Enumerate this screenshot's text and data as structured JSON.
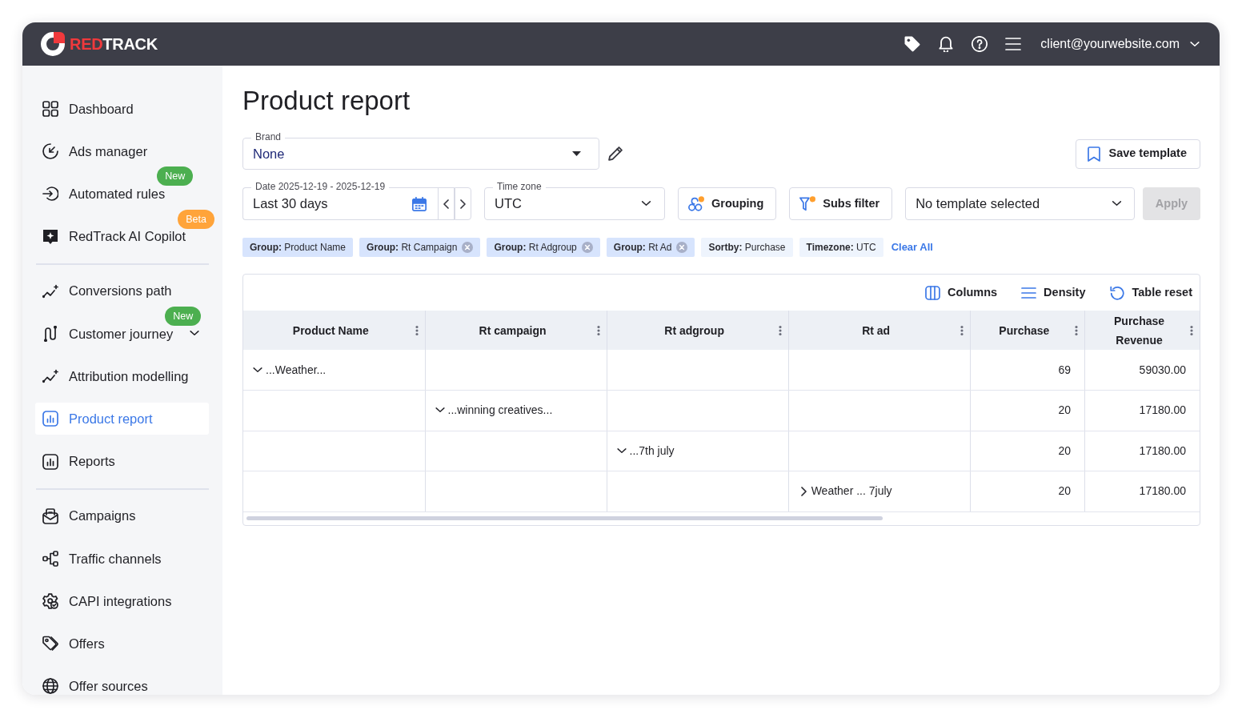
{
  "top_bar": {
    "logo": {
      "accent": "RED",
      "rest": "TRACK"
    },
    "account": {
      "email": "client@yourwebsite.com"
    }
  },
  "sidebar": {
    "sections": [
      {
        "items": [
          {
            "label": "Dashboard",
            "kind": "link",
            "selected": false
          },
          {
            "label": "Ads manager",
            "kind": "link",
            "selected": false
          },
          {
            "label": "Automated rules",
            "kind": "link",
            "selected": false,
            "badge": {
              "text": "New",
              "color": "#4caf50"
            }
          },
          {
            "label": "RedTrack AI Copilot",
            "kind": "link",
            "selected": false,
            "badge": {
              "text": "Beta",
              "color": "#ffa43a"
            }
          }
        ]
      },
      {
        "items": [
          {
            "label": "Conversions path",
            "kind": "link",
            "selected": false
          },
          {
            "label": "Customer journey",
            "kind": "group",
            "expanded": false,
            "selected": false,
            "badge": {
              "text": "New",
              "color": "#4caf50"
            }
          },
          {
            "label": "Attribution modelling",
            "kind": "link",
            "selected": false
          },
          {
            "label": "Product report",
            "kind": "link",
            "selected": true
          },
          {
            "label": "Reports",
            "kind": "link",
            "selected": false
          }
        ]
      },
      {
        "items": [
          {
            "label": "Campaigns",
            "kind": "link",
            "selected": false
          },
          {
            "label": "Traffic channels",
            "kind": "link",
            "selected": false
          },
          {
            "label": "CAPI integrations",
            "kind": "link",
            "selected": false
          },
          {
            "label": "Offers",
            "kind": "link",
            "selected": false
          },
          {
            "label": "Offer sources",
            "kind": "link",
            "selected": false
          }
        ]
      }
    ]
  },
  "page": {
    "title": "Product report",
    "brand_field": {
      "label": "Brand",
      "value": "None"
    },
    "save_template_button": {
      "label": "Save template"
    },
    "date_field": {
      "label": "Date 2025-12-19 - 2025-12-19",
      "value": "Last 30 days"
    },
    "time_zone_field": {
      "label": "Time zone",
      "value": "UTC"
    },
    "grouping_button": {
      "label": "Grouping",
      "indicator": true
    },
    "subs_filter_button": {
      "label": "Subs filter",
      "indicator": true
    },
    "template_select": {
      "value": "No template selected"
    },
    "apply_button": {
      "label": "Apply",
      "disabled": true
    },
    "filter_chips": [
      {
        "text": "**Group:** Product Name",
        "kind": "group",
        "removable": false
      },
      {
        "text": "**Group:** Rt Campaign",
        "kind": "group",
        "removable": true
      },
      {
        "text": "**Group:** Rt Adgroup",
        "kind": "group",
        "removable": true
      },
      {
        "text": "**Group:** Rt Ad",
        "kind": "group",
        "removable": true
      },
      {
        "text": "**Sortby:** Purchase",
        "kind": "info",
        "removable": false
      },
      {
        "text": "**Timezone:** UTC",
        "kind": "info",
        "removable": false
      }
    ],
    "clear_all_link": "Clear All",
    "table": {
      "toolbar": [
        {
          "label": "Columns",
          "kind": "columns"
        },
        {
          "label": "Density",
          "kind": "density"
        },
        {
          "label": "Table reset",
          "kind": "reset"
        }
      ],
      "columns": [
        {
          "label": "Product Name",
          "kind": "group"
        },
        {
          "label": "Rt campaign",
          "kind": "group"
        },
        {
          "label": "Rt adgroup",
          "kind": "group"
        },
        {
          "label": "Rt ad",
          "kind": "group"
        },
        {
          "label": "Purchase",
          "kind": "metric"
        },
        {
          "label": "Purchase Revenue",
          "kind": "metric"
        }
      ],
      "rows": [
        {
          "label": "...Weather...",
          "expanded": true,
          "values": [
            "69",
            "59030.00"
          ],
          "children": [
            {
              "label": "...winning creatives...",
              "expanded": true,
              "values": [
                "20",
                "17180.00"
              ],
              "children": [
                {
                  "label": "...7th july",
                  "expanded": true,
                  "values": [
                    "20",
                    "17180.00"
                  ],
                  "children": [
                    {
                      "label": "Weather ... 7july",
                      "expanded": false,
                      "values": [
                        "20",
                        "17180.00"
                      ]
                    }
                  ]
                }
              ]
            }
          ]
        }
      ]
    }
  }
}
